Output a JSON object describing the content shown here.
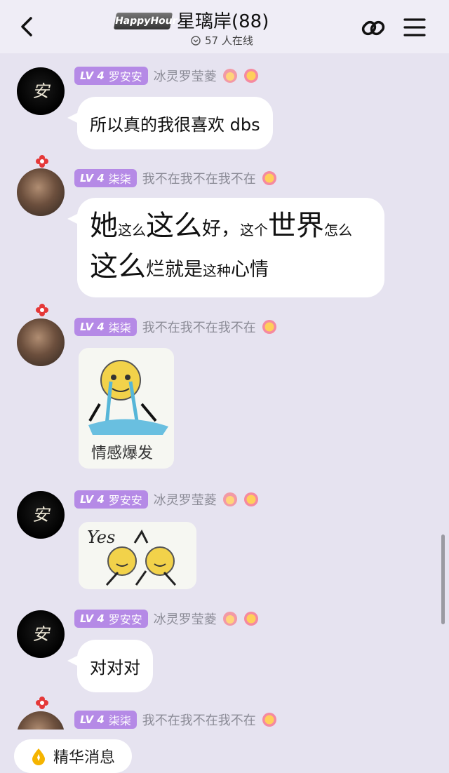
{
  "colors": {
    "background": "#e6e3f0",
    "header": "#efedf6",
    "level_badge": "#b58ae6"
  },
  "header": {
    "logo_text": "HappyHour",
    "group_name": "星璃岸(88)",
    "online_count": "57 人在线",
    "icons": [
      "back-icon",
      "link-icon",
      "menu-icon"
    ]
  },
  "messages": [
    {
      "level": "LV 4",
      "tag": "罗安安",
      "nick": "冰灵罗莹菱",
      "text": "所以真的我很喜欢 dbs"
    },
    {
      "level": "LV 4",
      "tag": "柒柒",
      "nick": "我不在我不在我不在",
      "line1": [
        "她",
        "这么",
        "这么",
        "好，",
        "这个",
        "世界",
        "怎么"
      ],
      "line2": [
        "这么",
        "烂就是",
        "这种",
        "心情"
      ]
    },
    {
      "level": "LV 4",
      "tag": "柒柒",
      "nick": "我不在我不在我不在",
      "sticker_caption": "情感爆发"
    },
    {
      "level": "LV 4",
      "tag": "罗安安",
      "nick": "冰灵罗莹菱",
      "sticker_caption": "Yes"
    },
    {
      "level": "LV 4",
      "tag": "罗安安",
      "nick": "冰灵罗莹菱",
      "text": "对对对"
    },
    {
      "level": "LV 4",
      "tag": "柒柒",
      "nick": "我不在我不在我不在"
    }
  ],
  "avatar_char": "安",
  "bottom": {
    "essence_label": "精华消息"
  }
}
